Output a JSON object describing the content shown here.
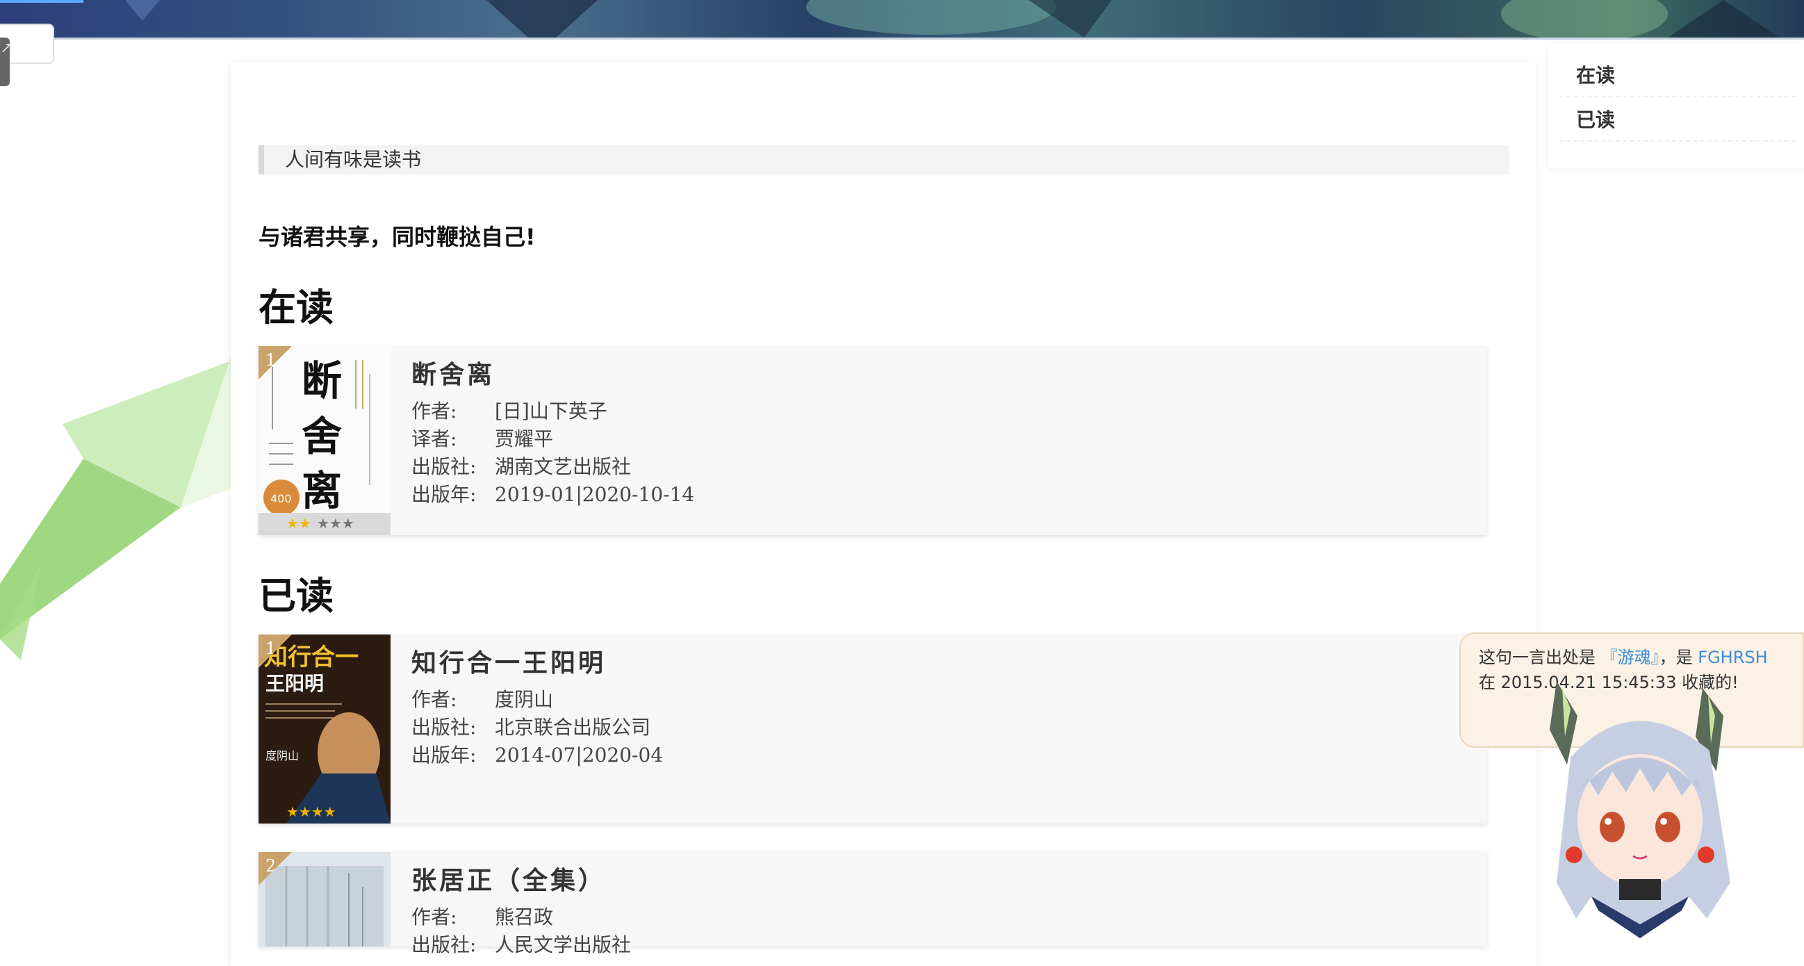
{
  "colors": {
    "accent_badge": "#c9a36a",
    "link_blue": "#3b8ed8",
    "speech_bg": "#fbf1e4"
  },
  "toc": {
    "items": [
      {
        "label": "在读"
      },
      {
        "label": "已读"
      }
    ]
  },
  "main": {
    "quote": "人间有味是读书",
    "motto": "与诸君共享，同时鞭挞自己!",
    "sections": [
      {
        "heading": "在读",
        "books": [
          {
            "rank": "1",
            "title": "断舍离",
            "cover_text": [
              "断",
              "舍",
              "离"
            ],
            "cover_badge": "400",
            "rating_stars": 2,
            "fields": [
              {
                "label": "作者:",
                "value": "[日]山下英子"
              },
              {
                "label": "译者:",
                "value": "贾耀平"
              },
              {
                "label": "出版社:",
                "value": "湖南文艺出版社"
              },
              {
                "label": "出版年:",
                "value": "2019-01|2020-10-14"
              }
            ]
          }
        ]
      },
      {
        "heading": "已读",
        "books": [
          {
            "rank": "1",
            "title": "知行合一王阳明",
            "cover_text": [
              "知行合一",
              "王阳明",
              "度阴山"
            ],
            "rating_stars": 4,
            "fields": [
              {
                "label": "作者:",
                "value": "度阴山"
              },
              {
                "label": "出版社:",
                "value": "北京联合出版公司"
              },
              {
                "label": "出版年:",
                "value": "2014-07|2020-04"
              }
            ]
          },
          {
            "rank": "2",
            "title": "张居正（全集）",
            "fields": [
              {
                "label": "作者:",
                "value": "熊召政"
              },
              {
                "label": "出版社:",
                "value": "人民文学出版社"
              }
            ]
          }
        ]
      }
    ]
  },
  "mascot": {
    "speech_pre": "这句一言出处是 ",
    "speech_source": "『游魂』",
    "speech_mid": "，是 ",
    "speech_user": "FGHRSH",
    "speech_post": " 在 2015.04.21 15:45:33 收藏的!"
  }
}
